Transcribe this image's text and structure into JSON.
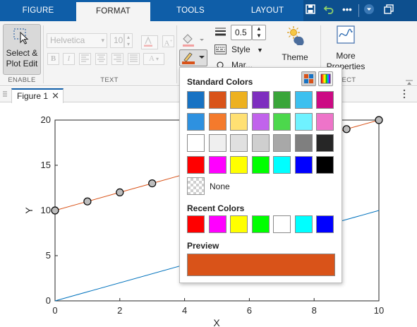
{
  "tabs": [
    "FIGURE",
    "FORMAT",
    "TOOLS",
    "LAYOUT"
  ],
  "active_tab": "FORMAT",
  "ribbon": {
    "enable": {
      "select_label_line1": "Select &",
      "select_label_line2": "Plot Edit",
      "group_label": "ENABLE"
    },
    "text": {
      "font_value": "Helvetica",
      "size_value": "10",
      "group_label": "TEXT"
    },
    "line": {
      "width_value": "0.5",
      "style_label": "Style",
      "marker_label": "Mar..."
    },
    "theme_label": "Theme",
    "more_props_line1": "More",
    "more_props_line2": "Properties",
    "more_group_label": "...ECT"
  },
  "figure_tab": "Figure 1",
  "plot": {
    "xlabel": "X",
    "ylabel": "Y",
    "xticks": [
      "0",
      "2",
      "4",
      "6",
      "8",
      "10"
    ],
    "yticks": [
      "0",
      "5",
      "10",
      "15",
      "20"
    ]
  },
  "chart_data": {
    "type": "line",
    "xlabel": "X",
    "ylabel": "Y",
    "xlim": [
      0,
      10
    ],
    "ylim": [
      0,
      20
    ],
    "series": [
      {
        "color": "#0072bd",
        "marker": "none",
        "x": [
          0,
          10
        ],
        "y": [
          0,
          10
        ]
      },
      {
        "color": "#d95319",
        "marker": "circle",
        "x": [
          0,
          1,
          2,
          3,
          4,
          5,
          6,
          7,
          8,
          9,
          10
        ],
        "y": [
          10,
          11,
          12,
          13,
          14,
          15,
          16,
          17,
          18,
          19,
          20
        ]
      }
    ]
  },
  "popup": {
    "standard_title": "Standard Colors",
    "none_label": "None",
    "recent_title": "Recent Colors",
    "preview_title": "Preview",
    "standard_colors": [
      [
        "#1772c3",
        "#d95319",
        "#edb120",
        "#7e2fbf",
        "#3aa53a",
        "#3cc0ef",
        "#cc0a84"
      ],
      [
        "#2e91e0",
        "#f47a2c",
        "#ffe073",
        "#c163ec",
        "#4cd84c",
        "#6ff2ff",
        "#ee74c9"
      ],
      [
        "#ffffff",
        "#efefef",
        "#e0e0e0",
        "#cfcfcf",
        "#a8a8a8",
        "#7f7f7f",
        "#262626"
      ],
      [
        "#ff0000",
        "#ff00ff",
        "#ffff00",
        "#00ff00",
        "#00ffff",
        "#0000ff",
        "#000000"
      ]
    ],
    "recent_colors": [
      "#ff0000",
      "#ff00ff",
      "#ffff00",
      "#00ff00",
      "#ffffff",
      "#00ffff",
      "#0000ff"
    ],
    "preview_color": "#d95319"
  }
}
